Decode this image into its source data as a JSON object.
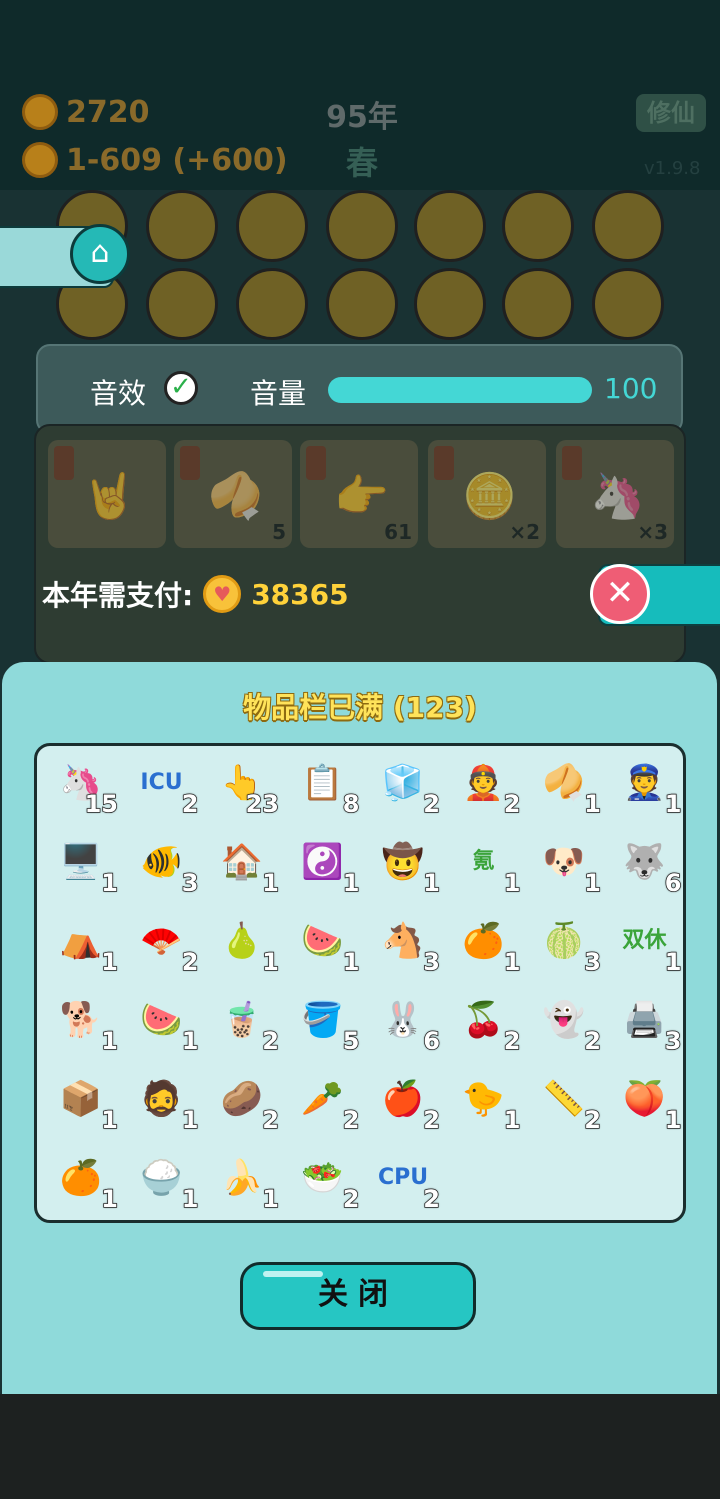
{
  "hud": {
    "coins": "2720",
    "income": "1-609 (+600)",
    "year": "95年",
    "season": "春",
    "xiuxian_button": "修仙",
    "version": "v1.9.8"
  },
  "icons": {
    "home": "home-icon",
    "close": "close-icon",
    "coin": "coin-icon"
  },
  "settings": {
    "sound_label": "音效",
    "sound_enabled": true,
    "volume_label": "音量",
    "volume_value": "100",
    "volume_level": 1.0
  },
  "shelf": {
    "counts": [
      "5",
      "61",
      "×2",
      "×3"
    ]
  },
  "payment": {
    "label": "本年需支付:",
    "amount": "38365"
  },
  "inventory": {
    "title": "物品栏已满 (123)",
    "items": [
      {
        "icon": "🦄",
        "count": "15"
      },
      {
        "icon": "ICU",
        "count": "2"
      },
      {
        "icon": "👆",
        "count": "23"
      },
      {
        "icon": "📋",
        "count": "8"
      },
      {
        "icon": "🧊",
        "count": "2"
      },
      {
        "icon": "👲",
        "count": "2"
      },
      {
        "icon": "🥠",
        "count": "1"
      },
      {
        "icon": "👮",
        "count": "1"
      },
      {
        "icon": "🖥️",
        "count": "1"
      },
      {
        "icon": "🐠",
        "count": "3"
      },
      {
        "icon": "🏠",
        "count": "1"
      },
      {
        "icon": "☯️",
        "count": "1"
      },
      {
        "icon": "🤠",
        "count": "1"
      },
      {
        "icon": "氪",
        "count": "1"
      },
      {
        "icon": "🐶",
        "count": "1"
      },
      {
        "icon": "🐺",
        "count": "6"
      },
      {
        "icon": "⛺",
        "count": "1"
      },
      {
        "icon": "🪭",
        "count": "2"
      },
      {
        "icon": "🍐",
        "count": "1"
      },
      {
        "icon": "🍉",
        "count": "1"
      },
      {
        "icon": "🐴",
        "count": "3"
      },
      {
        "icon": "🍊",
        "count": "1"
      },
      {
        "icon": "🍈",
        "count": "3"
      },
      {
        "icon": "双休",
        "count": "1"
      },
      {
        "icon": "🐕",
        "count": "1"
      },
      {
        "icon": "🍉",
        "count": "1"
      },
      {
        "icon": "🧋",
        "count": "2"
      },
      {
        "icon": "🪣",
        "count": "5"
      },
      {
        "icon": "🐰",
        "count": "6"
      },
      {
        "icon": "🍒",
        "count": "2"
      },
      {
        "icon": "👻",
        "count": "2"
      },
      {
        "icon": "🖨️",
        "count": "3"
      },
      {
        "icon": "📦",
        "count": "1"
      },
      {
        "icon": "🧔",
        "count": "1"
      },
      {
        "icon": "🥔",
        "count": "2"
      },
      {
        "icon": "🥕",
        "count": "2"
      },
      {
        "icon": "🍎",
        "count": "2"
      },
      {
        "icon": "🐤",
        "count": "1"
      },
      {
        "icon": "📏",
        "count": "2"
      },
      {
        "icon": "🍑",
        "count": "1"
      },
      {
        "icon": "🍊",
        "count": "1"
      },
      {
        "icon": "🍚",
        "count": "1"
      },
      {
        "icon": "🍌",
        "count": "1"
      },
      {
        "icon": "🥗",
        "count": "2"
      },
      {
        "icon": "CPU",
        "count": "2"
      }
    ],
    "close_button": "关闭"
  }
}
